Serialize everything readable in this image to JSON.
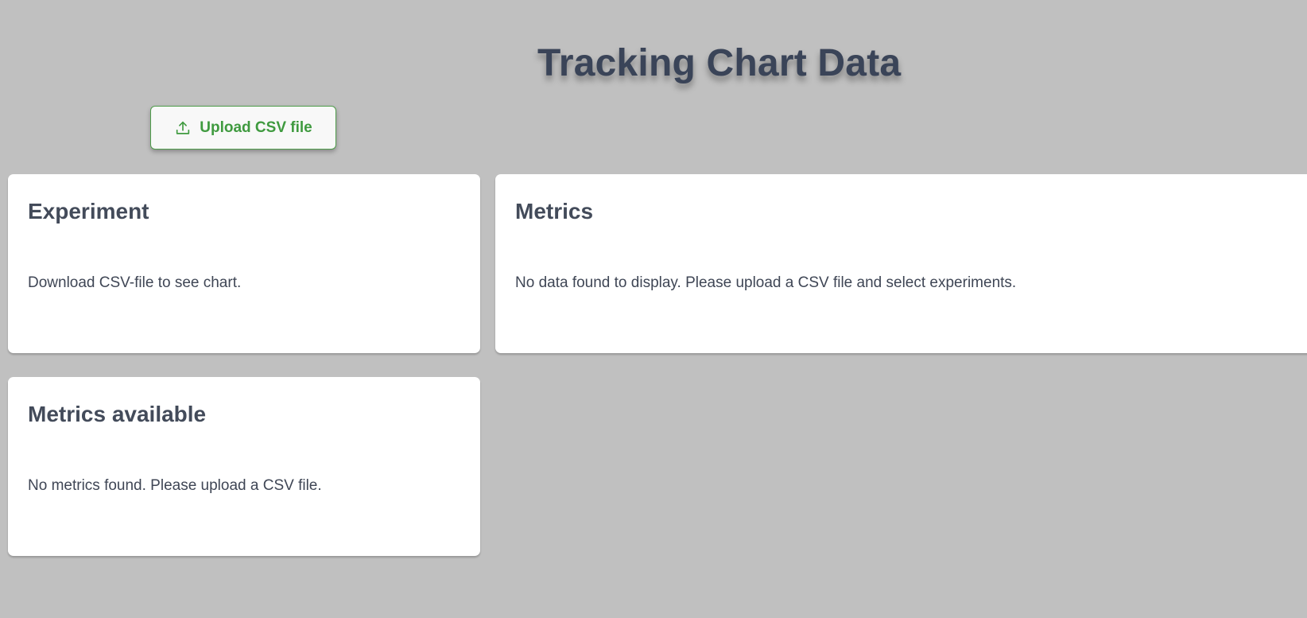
{
  "header": {
    "title": "Tracking Chart Data",
    "upload_button": {
      "label": "Upload CSV file",
      "icon": "upload-icon"
    }
  },
  "panels": {
    "experiment": {
      "title": "Experiment",
      "message": "Download CSV-file to see chart."
    },
    "metrics": {
      "title": "Metrics",
      "message": "No data found to display. Please upload a CSV file and select experiments."
    },
    "metrics_available": {
      "title": "Metrics available",
      "message": "No metrics found. Please upload a CSV file."
    }
  },
  "colors": {
    "background": "#c0c0c0",
    "panel_background": "#ffffff",
    "title": "#3a4458",
    "text": "#3f4655",
    "accent_green": "#3f9a3f"
  }
}
